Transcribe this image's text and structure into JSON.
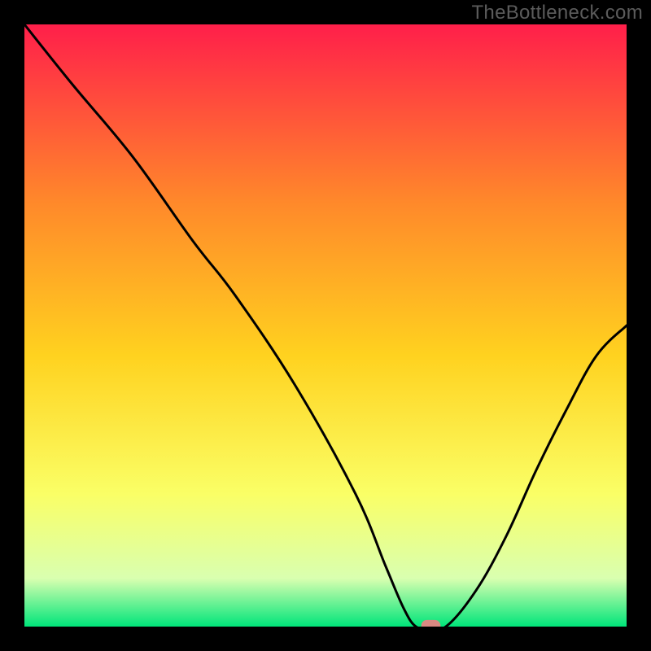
{
  "watermark": "TheBottleneck.com",
  "chart_data": {
    "type": "line",
    "title": "",
    "xlabel": "",
    "ylabel": "",
    "xlim": [
      0,
      100
    ],
    "ylim": [
      0,
      100
    ],
    "grid": false,
    "legend": false,
    "background_gradient": {
      "top": "#ff1f4a",
      "upper_mid": "#ff8a2a",
      "mid": "#ffd21f",
      "lower_mid": "#faff66",
      "near_bottom": "#d9ffb0",
      "bottom": "#00e57a"
    },
    "series": [
      {
        "name": "bottleneck-curve",
        "color": "#000000",
        "x": [
          0,
          8,
          18,
          28,
          35,
          45,
          55,
          60,
          63,
          65,
          67,
          70,
          75,
          80,
          85,
          90,
          95,
          100
        ],
        "y": [
          100,
          90,
          78,
          64,
          55,
          40,
          22,
          10,
          3,
          0,
          0,
          0,
          6,
          15,
          26,
          36,
          45,
          50
        ]
      }
    ],
    "marker": {
      "name": "optimal-point",
      "x": 67.5,
      "y": 0,
      "color": "#d98982",
      "shape": "rounded-rect",
      "width": 3.2,
      "height": 2.2
    }
  }
}
